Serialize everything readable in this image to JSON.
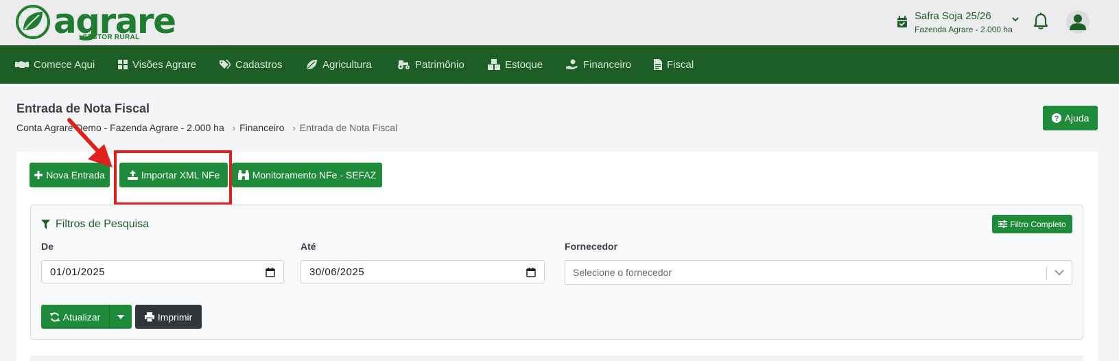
{
  "brand": {
    "name": "agrare",
    "tagline": "GESTOR RURAL"
  },
  "colors": {
    "brand_green": "#1e7d2e",
    "nav_bg": "#1d5e26",
    "button_green": "#1e8b3a",
    "highlight_red": "#e0201c",
    "dark_button": "#31363c"
  },
  "header": {
    "season": "Safra Soja 25/26",
    "farm": "Fazenda Agrare - 2.000 ha",
    "icons": [
      "calendar-check-icon",
      "chevron-down-icon",
      "bell-icon",
      "user-icon"
    ]
  },
  "nav": {
    "items": [
      {
        "label": "Comece Aqui",
        "icon": "handshake-icon"
      },
      {
        "label": "Visões Agrare",
        "icon": "grid-icon"
      },
      {
        "label": "Cadastros",
        "icon": "tags-icon"
      },
      {
        "label": "Agricultura",
        "icon": "leaf-icon"
      },
      {
        "label": "Patrimônio",
        "icon": "tractor-icon"
      },
      {
        "label": "Estoque",
        "icon": "boxes-icon"
      },
      {
        "label": "Financeiro",
        "icon": "hand-coin-icon"
      },
      {
        "label": "Fiscal",
        "icon": "file-invoice-icon"
      }
    ]
  },
  "page": {
    "title": "Entrada de Nota Fiscal",
    "breadcrumb": [
      "Conta Agrare Demo - Fazenda Agrare - 2.000 ha",
      "Financeiro",
      "Entrada de Nota Fiscal"
    ],
    "help_label": "Ajuda"
  },
  "actions": {
    "new_entry": "Nova Entrada",
    "import_xml": "Importar XML NFe",
    "monitoring": "Monitoramento NFe - SEFAZ"
  },
  "filters": {
    "title": "Filtros de Pesquisa",
    "full_filter": "Filtro Completo",
    "from_label": "De",
    "from_value": "01/01/2025",
    "to_label": "Até",
    "to_value": "30/06/2025",
    "supplier_label": "Fornecedor",
    "supplier_placeholder": "Selecione o fornecedor",
    "update_label": "Atualizar",
    "print_label": "Imprimir"
  }
}
